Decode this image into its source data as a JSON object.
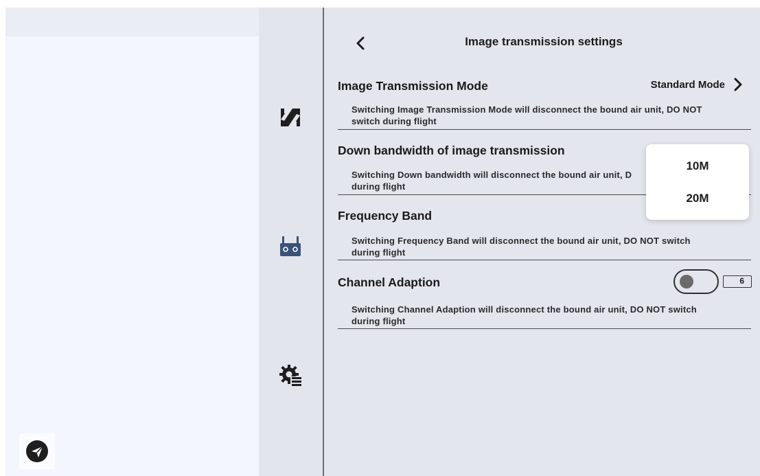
{
  "left_panel": {
    "send_icon": "paper-plane-icon"
  },
  "rail": {
    "items": [
      {
        "icon": "image-transmission-icon"
      },
      {
        "icon": "remote-controller-icon"
      },
      {
        "icon": "settings-list-icon"
      }
    ]
  },
  "header": {
    "back_icon": "chevron-left-icon",
    "title": "Image transmission settings"
  },
  "settings": [
    {
      "title": "Image Transmission Mode",
      "value": "Standard Mode",
      "description_line1": "Switching Image Transmission Mode will disconnect the bound air unit, DO NOT",
      "description_line2": "switch during flight"
    },
    {
      "title": "Down bandwidth of image transmission",
      "description_line1": "Switching Down bandwidth will disconnect the bound air unit, D",
      "description_line2": "during flight"
    },
    {
      "title": "Frequency Band",
      "description_line1": "Switching Frequency Band will disconnect the bound air unit, DO NOT switch",
      "description_line2": "during flight"
    },
    {
      "title": "Channel Adaption",
      "toggle_on": false,
      "channel_value": "6",
      "description_line1": "Switching Channel Adaption will disconnect the bound air unit, DO NOT switch",
      "description_line2": "during flight"
    }
  ],
  "dropdown": {
    "options": [
      "10M",
      "20M"
    ]
  },
  "colors": {
    "main_bg": "#e4e6ed",
    "left_bg": "#f3f6fc",
    "icon_blue": "#3a5277",
    "icon_dark": "#1e1e1e"
  }
}
